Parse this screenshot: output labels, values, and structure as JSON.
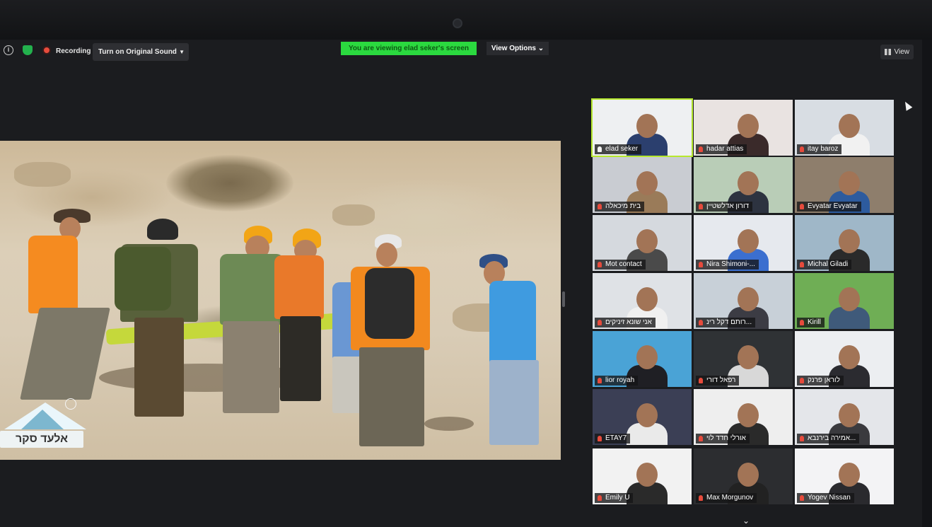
{
  "toolbar": {
    "recording_label": "Recording",
    "sound_button_label": "Turn on Original Sound",
    "viewing_banner": "You are viewing elad seker's screen",
    "view_options_label": "View Options ⌄",
    "view_label": "View"
  },
  "share": {
    "watermark_text": "אלעד סקר"
  },
  "participants": [
    {
      "name": "elad seker",
      "muted": false,
      "active": true,
      "bg": "#eef0f2",
      "shirt": "#2b3f6e"
    },
    {
      "name": "hadar attias",
      "muted": true,
      "active": false,
      "bg": "#e9e3e1",
      "shirt": "#3a2a2a"
    },
    {
      "name": "itay baroz",
      "muted": true,
      "active": false,
      "bg": "#d8dde3",
      "shirt": "#f1f1f1"
    },
    {
      "name": "בית מיכאלה",
      "muted": true,
      "active": false,
      "bg": "#c9ccd2",
      "shirt": "#9a7b59"
    },
    {
      "name": "דורון אדלשטיין",
      "muted": true,
      "active": false,
      "bg": "#b9cdb7",
      "shirt": "#2d3340"
    },
    {
      "name": "Evyatar Evyatar",
      "muted": true,
      "active": false,
      "bg": "#8e7e6c",
      "shirt": "#2d5b9e"
    },
    {
      "name": "Mot contact",
      "muted": true,
      "active": false,
      "bg": "#d5d9de",
      "shirt": "#4a4a4a"
    },
    {
      "name": "Nira Shimoni-...",
      "muted": true,
      "active": false,
      "bg": "#e6e9ee",
      "shirt": "#3b6fcf"
    },
    {
      "name": "Michal Giladi",
      "muted": true,
      "active": false,
      "bg": "#9fb7c8",
      "shirt": "#2a2a2a"
    },
    {
      "name": "אני שונא זיניקים",
      "muted": true,
      "active": false,
      "bg": "#dfe2e6",
      "shirt": "#f0f0f0"
    },
    {
      "name": "רותם דקל רינ...",
      "muted": true,
      "active": false,
      "bg": "#c8d0d8",
      "shirt": "#3c3c44"
    },
    {
      "name": "Kirill",
      "muted": true,
      "active": false,
      "bg": "#6fae55",
      "shirt": "#3f5a7a"
    },
    {
      "name": "lior royah",
      "muted": true,
      "active": false,
      "bg": "#4aa3d6",
      "shirt": "#1f1f24"
    },
    {
      "name": "רפאל דורי",
      "muted": true,
      "active": false,
      "bg": "#2f3235",
      "shirt": "#d8d8d8"
    },
    {
      "name": "לוראן פרנק",
      "muted": true,
      "active": false,
      "bg": "#eceef1",
      "shirt": "#2b2b30"
    },
    {
      "name": "ETAY7",
      "muted": true,
      "active": false,
      "bg": "#3b3f55",
      "shirt": "#eaeaea"
    },
    {
      "name": "אורלי חדד לוי",
      "muted": true,
      "active": false,
      "bg": "#eeeeee",
      "shirt": "#2a2a2a"
    },
    {
      "name": "אמירה בירנבא...",
      "muted": true,
      "active": false,
      "bg": "#e4e6ea",
      "shirt": "#3a3a3e"
    },
    {
      "name": "Emily U",
      "muted": true,
      "active": false,
      "bg": "#f2f2f2",
      "shirt": "#2a2a2a"
    },
    {
      "name": "Max Morgunov",
      "muted": true,
      "active": false,
      "bg": "#2c2d30",
      "shirt": "#222"
    },
    {
      "name": "Yogev Nissan",
      "muted": true,
      "active": false,
      "bg": "#f3f3f5",
      "shirt": "#2a2a2e"
    }
  ]
}
